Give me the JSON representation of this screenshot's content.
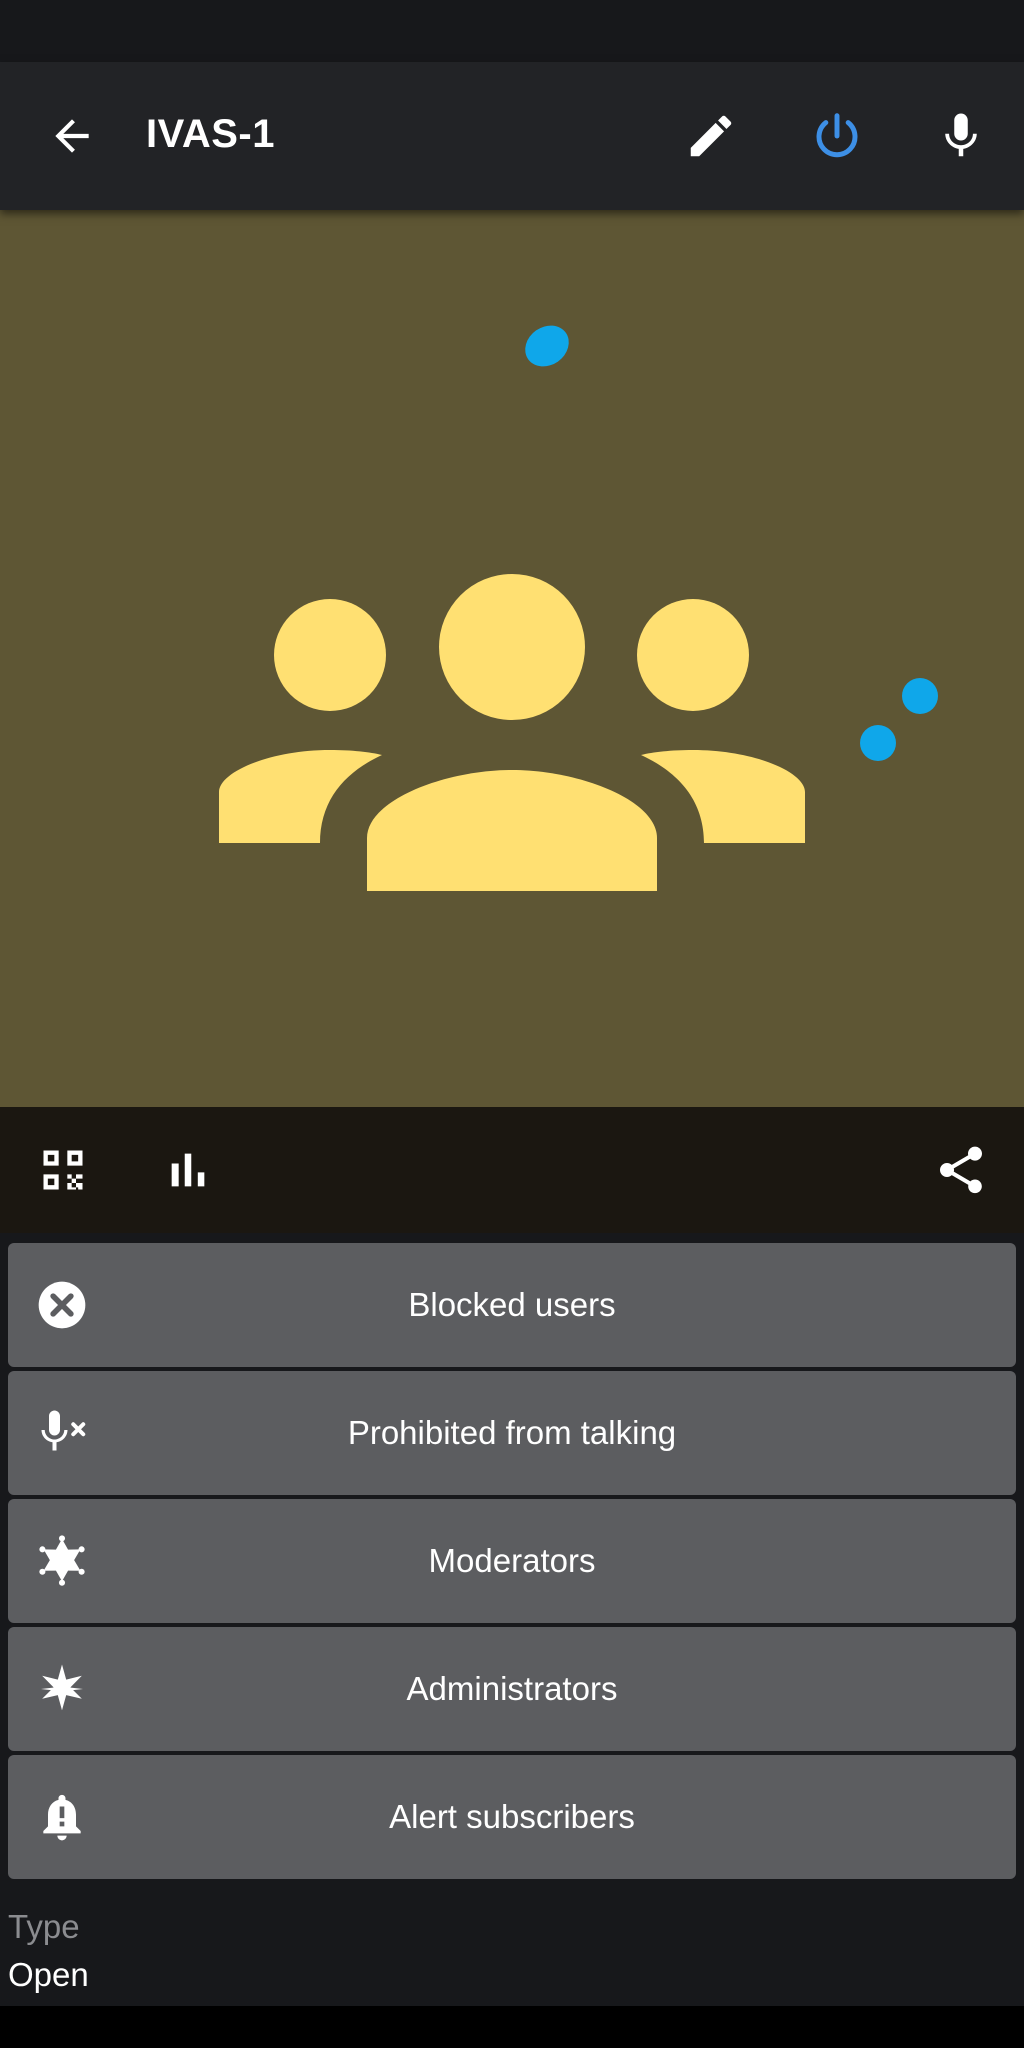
{
  "app_bar": {
    "title": "IVAS-1",
    "back_icon": "arrow-back-icon",
    "edit_icon": "pencil-icon",
    "power_icon": "power-icon",
    "mic_icon": "microphone-icon",
    "power_color": "#3d8fe6"
  },
  "hero": {
    "background": "#5e5634",
    "icon": "group-icon",
    "icon_color": "#ffe072",
    "indicator_color": "#0fa7ea"
  },
  "actions": {
    "qr_icon": "qr-code-icon",
    "stats_icon": "bar-chart-icon",
    "share_icon": "share-icon"
  },
  "menu": {
    "items": [
      {
        "label": "Blocked users",
        "icon": "close-circle-icon"
      },
      {
        "label": "Prohibited from talking",
        "icon": "mic-off-icon"
      },
      {
        "label": "Moderators",
        "icon": "sheriff-star-icon"
      },
      {
        "label": "Administrators",
        "icon": "star-burst-icon"
      },
      {
        "label": "Alert subscribers",
        "icon": "alert-bell-icon"
      }
    ]
  },
  "info": {
    "type_label": "Type",
    "type_value": "Open"
  }
}
